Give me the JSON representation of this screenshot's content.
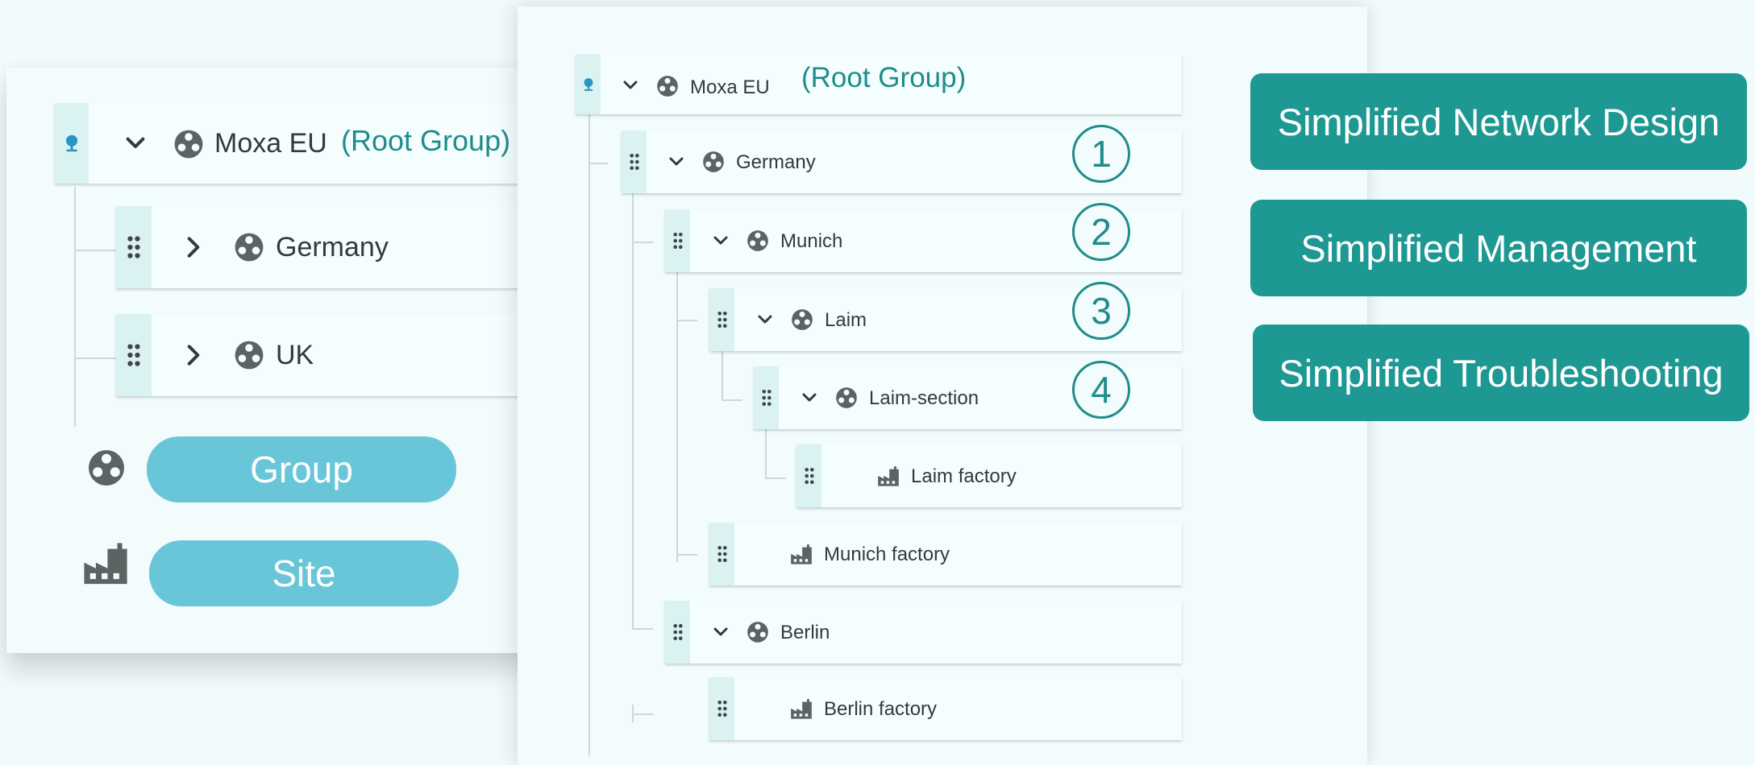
{
  "left": {
    "tree": {
      "root": {
        "label": "Moxa EU",
        "note": "(Root Group)",
        "icon": "map-pin-icon"
      },
      "children": [
        {
          "label": "Germany",
          "icon": "group-icon",
          "state": "collapsed"
        },
        {
          "label": "UK",
          "icon": "group-icon",
          "state": "collapsed"
        }
      ]
    },
    "legend": [
      {
        "icon": "group-icon",
        "label": "Group"
      },
      {
        "icon": "factory-icon",
        "label": "Site"
      }
    ]
  },
  "right": {
    "tree": {
      "root": {
        "label": "Moxa EU",
        "note": "(Root Group)"
      },
      "nodes": [
        {
          "label": "Germany",
          "type": "group",
          "level_marker": "1"
        },
        {
          "label": "Munich",
          "type": "group",
          "level_marker": "2"
        },
        {
          "label": "Laim",
          "type": "group",
          "level_marker": "3"
        },
        {
          "label": "Laim-section",
          "type": "group",
          "level_marker": "4"
        },
        {
          "label": "Laim factory",
          "type": "site"
        },
        {
          "label": "Munich factory",
          "type": "site"
        },
        {
          "label": "Berlin",
          "type": "group"
        },
        {
          "label": "Berlin factory",
          "type": "site"
        }
      ]
    }
  },
  "features": [
    {
      "label": "Simplified Network Design"
    },
    {
      "label": "Simplified Management"
    },
    {
      "label": "Simplified Troubleshooting"
    }
  ],
  "colors": {
    "accent": "#1e9893",
    "pill": "#69c5d8",
    "root_text": "#1f8c8c",
    "handle": "#dbf2f3"
  }
}
